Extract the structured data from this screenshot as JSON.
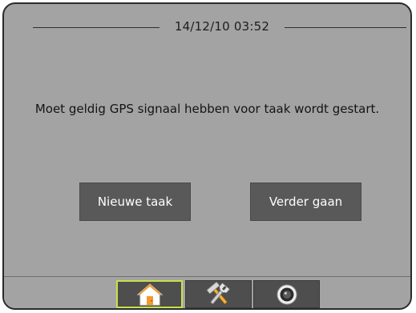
{
  "header": {
    "datetime": "14/12/10 03:52"
  },
  "dialog": {
    "message": "Moet geldig GPS signaal hebben voor taak wordt gestart.",
    "new_task_label": "Nieuwe taak",
    "continue_label": "Verder gaan"
  },
  "tabs": [
    {
      "icon": "home-icon",
      "active": true
    },
    {
      "icon": "tools-icon",
      "active": false
    },
    {
      "icon": "camera-icon",
      "active": false
    }
  ],
  "colors": {
    "screen_background": "#a3a3a3",
    "button_background": "#595959",
    "tab_background": "#4e4e4e",
    "active_tab_border": "#c8e04a",
    "home_icon_orange": "#f29a2e"
  }
}
